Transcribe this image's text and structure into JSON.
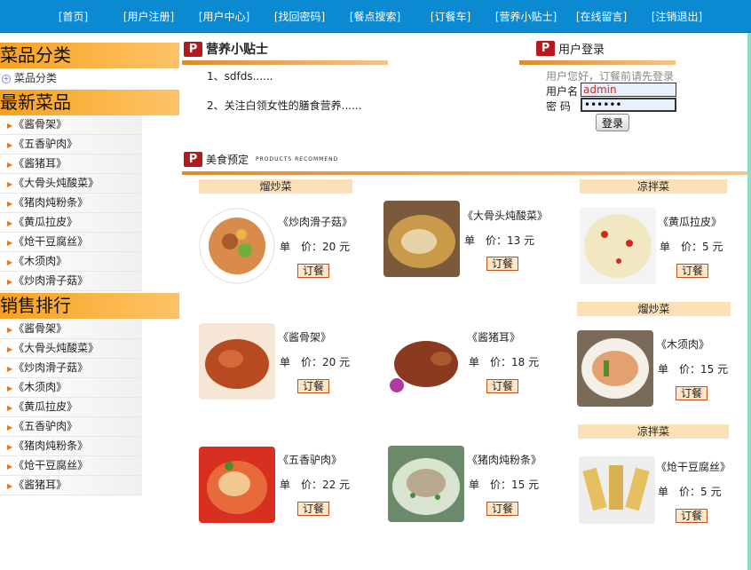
{
  "nav": {
    "items": [
      "[首页]",
      "[用户注册]",
      "[用户中心]",
      "[找回密码]",
      "[餐点搜索]",
      "[订餐车]",
      "[营养小贴士]",
      "[在线留言]",
      "[注销退出]"
    ]
  },
  "sidebar": {
    "category_title": "菜品分类",
    "category_item": "菜品分类",
    "latest_title": "最新菜品",
    "latest_items": [
      "《酱骨架》",
      "《五香驴肉》",
      "《酱猪耳》",
      "《大骨头炖酸菜》",
      "《猪肉炖粉条》",
      "《黄瓜拉皮》",
      "《炝干豆腐丝》",
      "《木须肉》",
      "《炒肉滑子菇》"
    ],
    "sales_title": "销售排行",
    "sales_items": [
      "《酱骨架》",
      "《大骨头炖酸菜》",
      "《炒肉滑子菇》",
      "《木须肉》",
      "《黄瓜拉皮》",
      "《五香驴肉》",
      "《猪肉炖粉条》",
      "《炝干豆腐丝》",
      "《酱猪耳》"
    ]
  },
  "tips": {
    "title": "营养小贴士",
    "items": [
      "1、sdfds......",
      "2、关注白领女性的膳食营养......"
    ]
  },
  "login": {
    "title": "用户登录",
    "hint": "用户您好，订餐前请先登录",
    "username_label": "用户名",
    "username_value": "admin",
    "password_label": "密 码",
    "password_value": "••••••",
    "submit": "登录"
  },
  "recommend": {
    "title": "美食预定",
    "subtitle": "PRODUCTS RECOMMEND",
    "price_label": "单　价：",
    "order_label": "订餐",
    "categories": [
      "熘炒菜",
      "凉拌菜",
      "熘炒菜",
      "凉拌菜"
    ],
    "products": [
      {
        "name": "《炒肉滑子菇》",
        "price": "20 元"
      },
      {
        "name": "《大骨头炖酸菜》",
        "price": "13 元"
      },
      {
        "name": "《黄瓜拉皮》",
        "price": "5 元"
      },
      {
        "name": "《酱骨架》",
        "price": "20 元"
      },
      {
        "name": "《酱猪耳》",
        "price": "18 元"
      },
      {
        "name": "《木须肉》",
        "price": "15 元"
      },
      {
        "name": "《五香驴肉》",
        "price": "22 元"
      },
      {
        "name": "《猪肉炖粉条》",
        "price": "15 元"
      },
      {
        "name": "《炝干豆腐丝》",
        "price": "5 元"
      }
    ]
  },
  "colors": {
    "nav": "#0b89d1",
    "accent": "#f9a020",
    "order_border": "#c1501a"
  }
}
